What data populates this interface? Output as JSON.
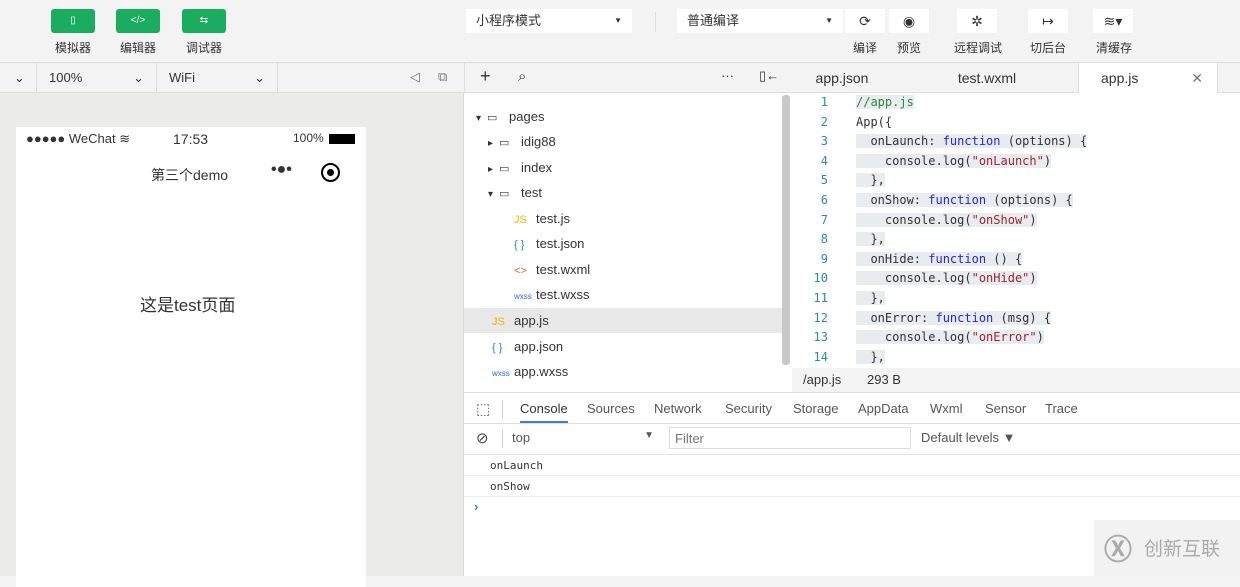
{
  "toolbar": {
    "simulator": "模拟器",
    "editor": "编辑器",
    "debugger": "调试器",
    "mode": "小程序模式",
    "compile_mode": "普通编译",
    "compile": "编译",
    "preview": "预览",
    "remote_debug": "远程调试",
    "background": "切后台",
    "clear_cache": "清缓存",
    "accent": "#1aad5f"
  },
  "sim_bar": {
    "zoom": "100%",
    "network": "WiFi"
  },
  "phone": {
    "carrier": "●●●●● WeChat",
    "time": "17:53",
    "battery": "100%",
    "title": "第三个demo",
    "body": "这是test页面"
  },
  "tree": {
    "items": [
      {
        "label": "pages",
        "type": "folder-open"
      },
      {
        "label": "idig88",
        "type": "folder"
      },
      {
        "label": "index",
        "type": "folder"
      },
      {
        "label": "test",
        "type": "folder-open"
      },
      {
        "label": "test.js",
        "type": "js"
      },
      {
        "label": "test.json",
        "type": "json"
      },
      {
        "label": "test.wxml",
        "type": "wxml"
      },
      {
        "label": "test.wxss",
        "type": "wxss"
      },
      {
        "label": "app.js",
        "type": "js"
      },
      {
        "label": "app.json",
        "type": "json"
      },
      {
        "label": "app.wxss",
        "type": "wxss"
      }
    ]
  },
  "editor": {
    "tabs": [
      "app.json",
      "test.wxml",
      "app.js"
    ],
    "active_tab": "app.js",
    "path": "/app.js",
    "size": "293 B"
  },
  "devtools": {
    "tabs": [
      "Console",
      "Sources",
      "Network",
      "Security",
      "Storage",
      "AppData",
      "Wxml",
      "Sensor",
      "Trace"
    ],
    "context": "top",
    "filter_placeholder": "Filter",
    "levels": "Default levels ▼",
    "logs": [
      "onLaunch",
      "onShow"
    ]
  },
  "watermark": "创新互联"
}
